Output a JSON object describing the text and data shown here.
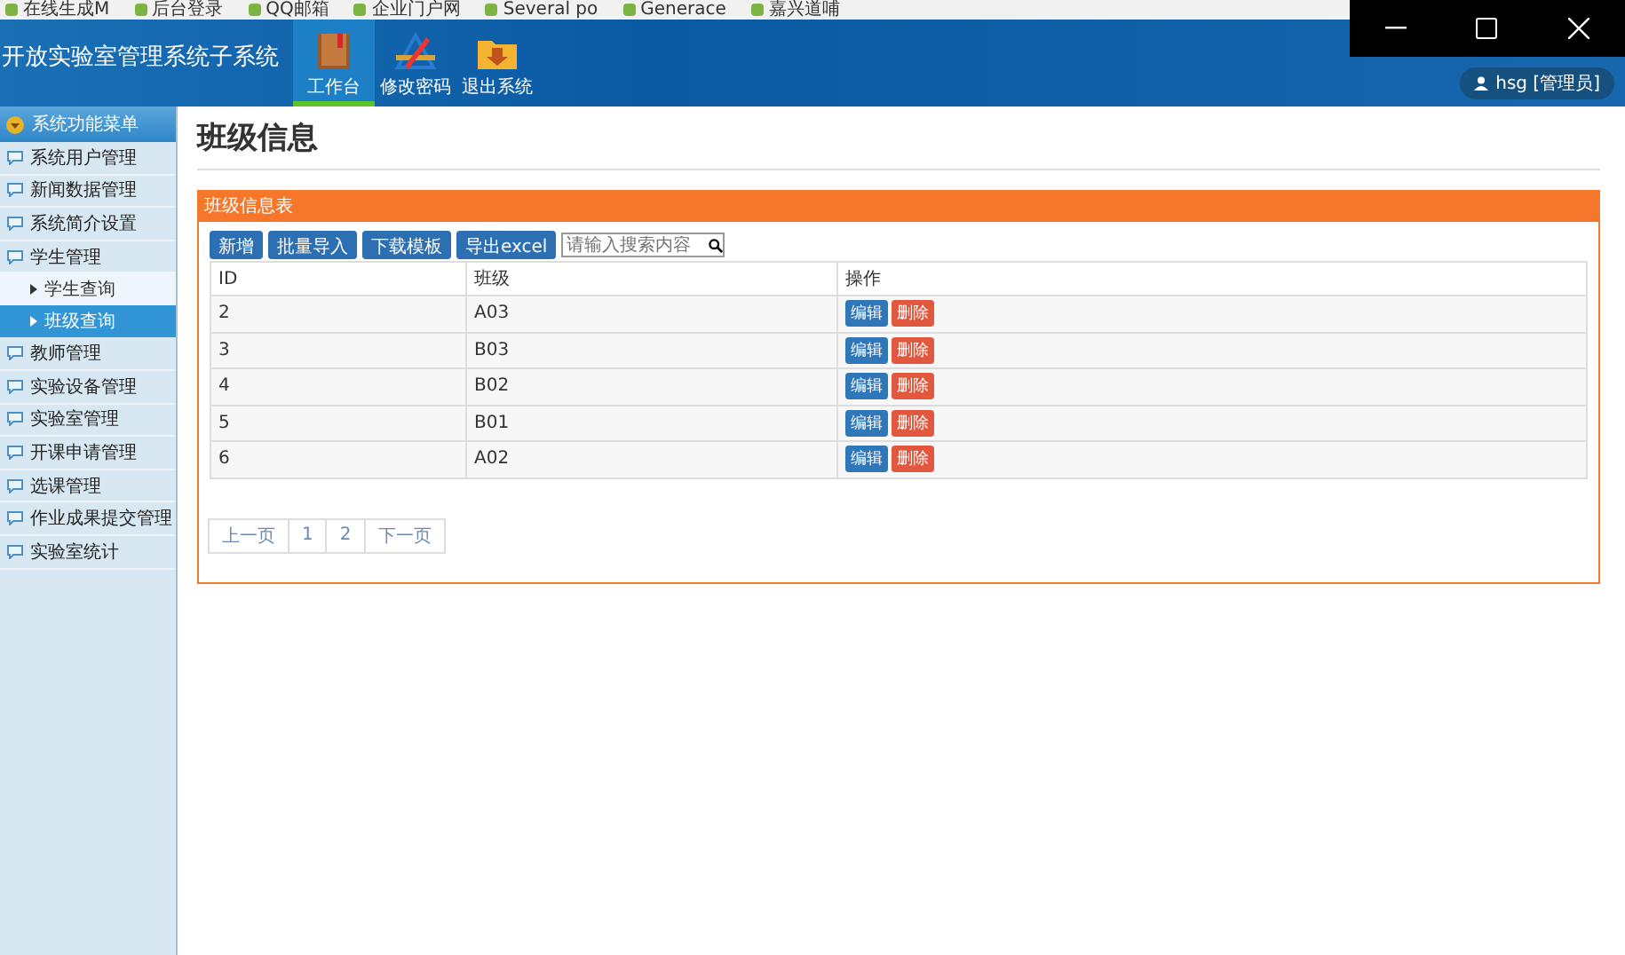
{
  "bookmarks": [
    "在线生成M",
    "后台登录",
    "QQ邮箱",
    "企业门户网",
    "Several po",
    "Generace",
    "嘉兴道哺"
  ],
  "header": {
    "title": "开放实验室管理系统子系统",
    "nav": [
      {
        "label": "工作台",
        "selected": true
      },
      {
        "label": "修改密码",
        "selected": false
      },
      {
        "label": "退出系统",
        "selected": false
      }
    ],
    "user": "hsg [管理员]"
  },
  "sidebar": {
    "heading": "系统功能菜单",
    "items": [
      {
        "label": "系统用户管理"
      },
      {
        "label": "新闻数据管理"
      },
      {
        "label": "系统简介设置"
      },
      {
        "label": "学生管理",
        "children": [
          {
            "label": "学生查询",
            "selected": false
          },
          {
            "label": "班级查询",
            "selected": true
          }
        ]
      },
      {
        "label": "教师管理"
      },
      {
        "label": "实验设备管理"
      },
      {
        "label": "实验室管理"
      },
      {
        "label": "开课申请管理"
      },
      {
        "label": "选课管理"
      },
      {
        "label": "作业成果提交管理"
      },
      {
        "label": "实验室统计"
      }
    ]
  },
  "page_title": "班级信息",
  "panel": {
    "title": "班级信息表",
    "toolbar": [
      "新增",
      "批量导入",
      "下载模板",
      "导出excel"
    ],
    "search": {
      "placeholder": "请输入搜索内容"
    },
    "table": {
      "columns": [
        "ID",
        "班级",
        "操作"
      ],
      "rows": [
        {
          "id": "2",
          "class": "A03",
          "actions": [
            {
              "kind": "edit",
              "label": "编辑"
            },
            {
              "kind": "delete",
              "label": "删除"
            }
          ]
        },
        {
          "id": "3",
          "class": "B03",
          "actions": [
            {
              "kind": "edit",
              "label": "编辑"
            },
            {
              "kind": "delete",
              "label": "删除"
            }
          ]
        },
        {
          "id": "4",
          "class": "B02",
          "actions": [
            {
              "kind": "edit",
              "label": "编辑"
            },
            {
              "kind": "delete",
              "label": "删除"
            }
          ]
        },
        {
          "id": "5",
          "class": "B01",
          "actions": [
            {
              "kind": "edit",
              "label": "编辑"
            },
            {
              "kind": "delete",
              "label": "删除"
            }
          ]
        },
        {
          "id": "6",
          "class": "A02",
          "actions": [
            {
              "kind": "edit",
              "label": "编辑"
            },
            {
              "kind": "delete",
              "label": "删除"
            }
          ]
        }
      ]
    },
    "pagination": [
      "上一页",
      "1",
      "2",
      "下一页"
    ]
  }
}
